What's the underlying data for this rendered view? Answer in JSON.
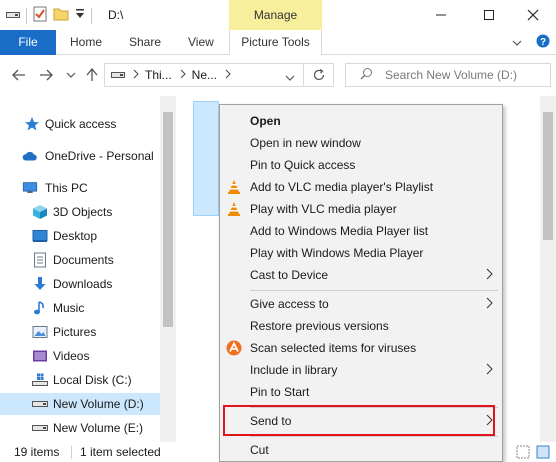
{
  "window": {
    "address_title": "D:\\",
    "contextual_group": "Manage"
  },
  "ribbon": {
    "tabs": [
      "File",
      "Home",
      "Share",
      "View",
      "Picture Tools"
    ]
  },
  "address": {
    "crumbs": [
      "Thi...",
      "Ne..."
    ],
    "search_placeholder": "Search New Volume (D:)"
  },
  "nav": {
    "items": [
      {
        "label": "Quick access",
        "icon": "star-icon"
      },
      {
        "label": "OneDrive - Personal",
        "icon": "cloud-icon"
      },
      {
        "label": "This PC",
        "icon": "computer-icon"
      },
      {
        "label": "3D Objects",
        "icon": "cube-icon"
      },
      {
        "label": "Desktop",
        "icon": "desktop-icon"
      },
      {
        "label": "Documents",
        "icon": "documents-icon"
      },
      {
        "label": "Downloads",
        "icon": "download-icon"
      },
      {
        "label": "Music",
        "icon": "music-icon"
      },
      {
        "label": "Pictures",
        "icon": "pictures-icon"
      },
      {
        "label": "Videos",
        "icon": "videos-icon"
      },
      {
        "label": "Local Disk (C:)",
        "icon": "drive-icon"
      },
      {
        "label": "New Volume (D:)",
        "icon": "drive-icon"
      },
      {
        "label": "New Volume (E:)",
        "icon": "drive-icon"
      }
    ],
    "selected": "New Volume (D:)"
  },
  "status": {
    "item_count": "19 items",
    "selection": "1 item selected"
  },
  "context_menu": {
    "items": [
      {
        "label": "Open",
        "bold": true
      },
      {
        "label": "Open in new window"
      },
      {
        "label": "Pin to Quick access"
      },
      {
        "label": "Add to VLC media player's Playlist",
        "icon": "vlc-icon"
      },
      {
        "label": "Play with VLC media player",
        "icon": "vlc-icon"
      },
      {
        "label": "Add to Windows Media Player list"
      },
      {
        "label": "Play with Windows Media Player"
      },
      {
        "label": "Cast to Device",
        "submenu": true
      },
      {
        "label": "Give access to",
        "submenu": true
      },
      {
        "label": "Restore previous versions"
      },
      {
        "label": "Scan selected items for viruses",
        "icon": "avast-icon"
      },
      {
        "label": "Include in library",
        "submenu": true
      },
      {
        "label": "Pin to Start"
      },
      {
        "label": "Send to",
        "submenu": true
      },
      {
        "label": "Cut"
      }
    ]
  },
  "colors": {
    "accent": "#1a6dc7",
    "contextual": "#f8ef9d",
    "selection": "#cce8ff",
    "highlight_box": "#e1141c"
  }
}
